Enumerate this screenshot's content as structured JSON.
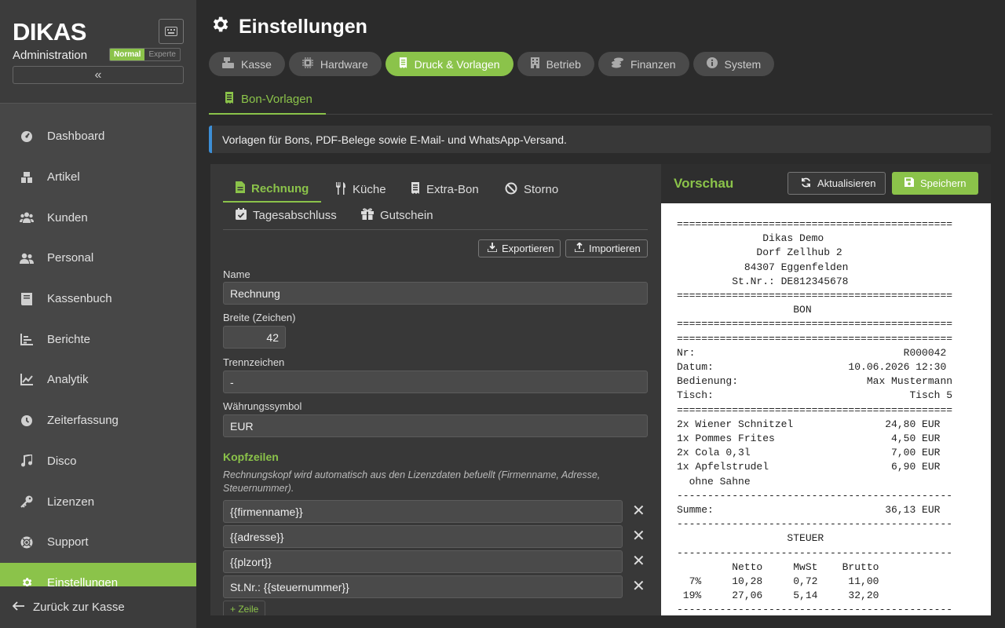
{
  "sidebar": {
    "logo": "DIKAS",
    "subtitle": "Administration",
    "mode_normal": "Normal",
    "mode_expert": "Experte",
    "items": [
      {
        "label": "Dashboard",
        "icon": "dashboard-icon"
      },
      {
        "label": "Artikel",
        "icon": "box-icon"
      },
      {
        "label": "Kunden",
        "icon": "users-icon"
      },
      {
        "label": "Personal",
        "icon": "staff-icon"
      },
      {
        "label": "Kassenbuch",
        "icon": "book-icon"
      },
      {
        "label": "Berichte",
        "icon": "bar-chart-icon"
      },
      {
        "label": "Analytik",
        "icon": "line-chart-icon"
      },
      {
        "label": "Zeiterfassung",
        "icon": "clock-icon"
      },
      {
        "label": "Disco",
        "icon": "music-icon"
      },
      {
        "label": "Lizenzen",
        "icon": "key-icon"
      },
      {
        "label": "Support",
        "icon": "lifering-icon"
      },
      {
        "label": "Einstellungen",
        "icon": "gear-icon"
      }
    ],
    "back_label": "Zurück zur Kasse"
  },
  "page": {
    "title": "Einstellungen",
    "tabs": [
      {
        "label": "Kasse"
      },
      {
        "label": "Hardware"
      },
      {
        "label": "Druck & Vorlagen"
      },
      {
        "label": "Betrieb"
      },
      {
        "label": "Finanzen"
      },
      {
        "label": "System"
      }
    ],
    "subtab": "Bon-Vorlagen",
    "info": "Vorlagen für Bons, PDF-Belege sowie E-Mail- und WhatsApp-Versand."
  },
  "editor": {
    "tpl_tabs": [
      "Rechnung",
      "Küche",
      "Extra-Bon",
      "Storno",
      "Tagesabschluss",
      "Gutschein"
    ],
    "export_label": "Exportieren",
    "import_label": "Importieren",
    "name_label": "Name",
    "name_value": "Rechnung",
    "width_label": "Breite (Zeichen)",
    "width_value": "42",
    "sep_label": "Trennzeichen",
    "sep_value": "-",
    "currency_label": "Währungssymbol",
    "currency_value": "EUR",
    "header_section": "Kopfzeilen",
    "header_note": "Rechnungskopf wird automatisch aus den Lizenzdaten befuellt (Firmenname, Adresse, Steuernummer).",
    "header_lines": [
      "{{firmenname}}",
      "{{adresse}}",
      "{{plzort}}",
      "St.Nr.: {{steuernummer}}"
    ],
    "add_line": "+ Zeile"
  },
  "preview": {
    "title": "Vorschau",
    "refresh_label": "Aktualisieren",
    "save_label": "Speichern",
    "receipt_lines": [
      "=============================================",
      "              Dikas Demo",
      "             Dorf Zellhub 2",
      "           84307 Eggenfelden",
      "         St.Nr.: DE812345678",
      "=============================================",
      "                   BON",
      "=============================================",
      "=============================================",
      "Nr:                                  R000042",
      "Datum:                      10.06.2026 12:30",
      "Bedienung:                     Max Mustermann",
      "Tisch:                                Tisch 5",
      "=============================================",
      "2x Wiener Schnitzel               24,80 EUR",
      "1x Pommes Frites                   4,50 EUR",
      "2x Cola 0,3l                       7,00 EUR",
      "1x Apfelstrudel                    6,90 EUR",
      "  ohne Sahne",
      "---------------------------------------------",
      "Summe:                            36,13 EUR",
      "---------------------------------------------",
      "                  STEUER",
      "---------------------------------------------",
      "         Netto     MwSt    Brutto",
      "  7%     10,28     0,72     11,00",
      " 19%     27,06     5,14     32,20",
      "---------------------------------------------"
    ]
  }
}
